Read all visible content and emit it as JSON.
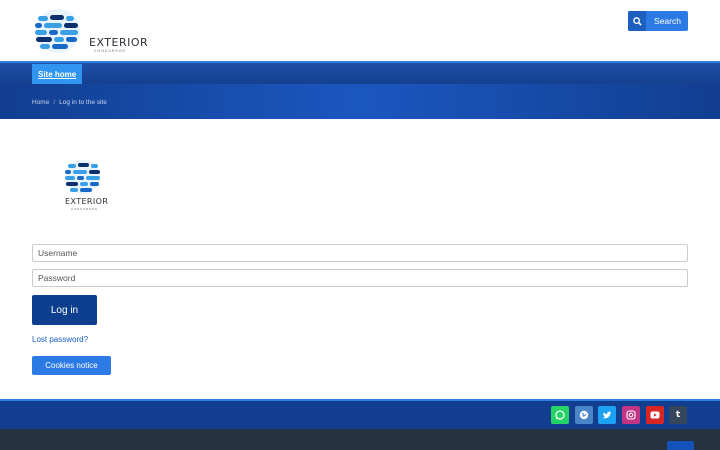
{
  "header": {
    "logo_text": "EXTERIOR",
    "logo_subtext": "CONCURSOS",
    "search_label": "Search"
  },
  "nav": {
    "site_home": "Site home"
  },
  "breadcrumb": {
    "home": "Home",
    "separator": "/",
    "current": "Log in to the site"
  },
  "login": {
    "logo_text": "EXTERIOR",
    "logo_subtext": "CONCURSOS",
    "username_placeholder": "Username",
    "password_placeholder": "Password",
    "login_label": "Log in",
    "lost_password": "Lost password?",
    "cookies_label": "Cookies notice"
  },
  "footer": {
    "social_icons": [
      "whatsapp-icon",
      "globe-icon",
      "twitter-icon",
      "instagram-icon",
      "youtube-icon",
      "tumblr-icon"
    ]
  },
  "colors": {
    "primary": "#2c7be5",
    "navy": "#0e3f8f",
    "nav_bar": "#1f4ea8",
    "footer_dark": "#243240"
  }
}
